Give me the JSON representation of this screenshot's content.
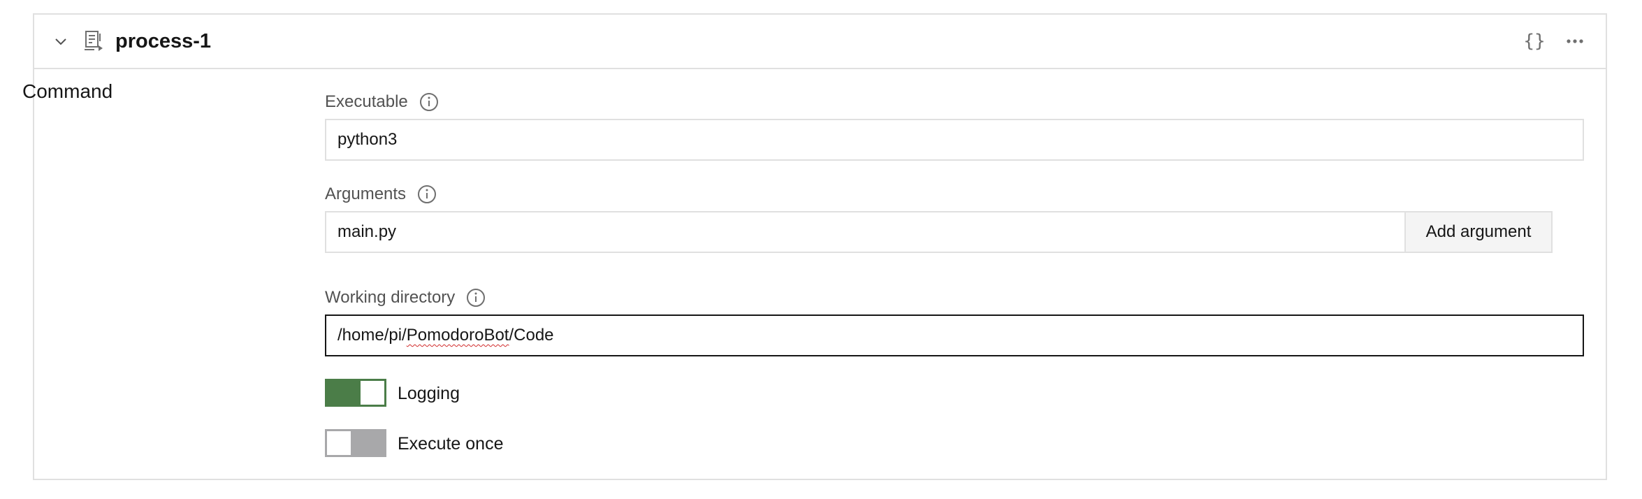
{
  "process": {
    "title": "process-1",
    "json_button_label": "{}",
    "section_label": "Command"
  },
  "icons": {
    "collapse": "chevron-down-icon",
    "process": "process-file-icon",
    "more": "overflow-menu-icon",
    "info": "info-icon"
  },
  "executable": {
    "label": "Executable",
    "value": "python3"
  },
  "arguments": {
    "label": "Arguments",
    "value": "main.py",
    "add_button_label": "Add argument"
  },
  "working_directory": {
    "label": "Working directory",
    "value_prefix": "/home/pi/",
    "value_misspelled": "PomodoroBot",
    "value_suffix": "/Code",
    "value": "/home/pi/PomodoroBot/Code"
  },
  "toggles": {
    "logging": {
      "label": "Logging",
      "on": true
    },
    "execute_once": {
      "label": "Execute once",
      "on": false
    }
  },
  "colors": {
    "toggle_on": "#4b7d48",
    "toggle_off": "#a8a8aa",
    "border": "#e0e0e0",
    "focus_border": "#161616"
  }
}
